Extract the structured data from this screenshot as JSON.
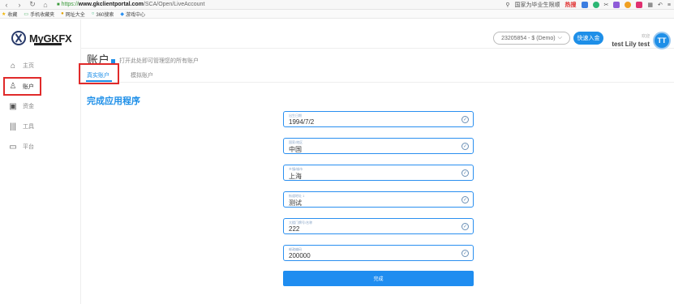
{
  "browser": {
    "url_protocol": "https://",
    "url_host": "www.gkclientportal.com",
    "url_path": "/SCA/Open/LiveAccount",
    "search_hint": "国家为毕业生限顺",
    "hot_label": "热搜",
    "bookmarks": [
      "收藏",
      "手机收藏夹",
      "网址大全",
      "360搜索",
      "游戏中心"
    ]
  },
  "logo": {
    "text": "MyGKFX"
  },
  "sidebar": {
    "items": [
      {
        "label": "主页",
        "icon": "home-icon"
      },
      {
        "label": "账户",
        "icon": "user-icon"
      },
      {
        "label": "资金",
        "icon": "wallet-icon"
      },
      {
        "label": "工具",
        "icon": "tools-icon"
      },
      {
        "label": "平台",
        "icon": "platform-icon"
      }
    ]
  },
  "topbar": {
    "account_selector": "23205854 - $ (Demo)",
    "deposit_label": "快速入金",
    "welcome": "欢迎",
    "username": "test Lily test",
    "avatar_initials": "TT"
  },
  "page": {
    "title": "账户",
    "subtitle": "打开此处即可管理您的所有账户",
    "tabs": [
      {
        "label": "真实账户",
        "active": true
      },
      {
        "label": "模拟账户",
        "active": false
      }
    ],
    "section_title": "完成应用程序"
  },
  "form": {
    "fields": [
      {
        "label": "出生日期",
        "value": "1994/7/2"
      },
      {
        "label": "国家/地区",
        "value": "中国"
      },
      {
        "label": "乡镇/城市",
        "value": "上海"
      },
      {
        "label": "街道地址 1",
        "value": "测试"
      },
      {
        "label": "大楼门牌号/名称",
        "value": "222"
      },
      {
        "label": "邮政编码",
        "value": "200000"
      }
    ],
    "submit_label": "完成"
  },
  "colors": {
    "accent": "#1e8fe8",
    "highlight": "#e02a2a"
  }
}
